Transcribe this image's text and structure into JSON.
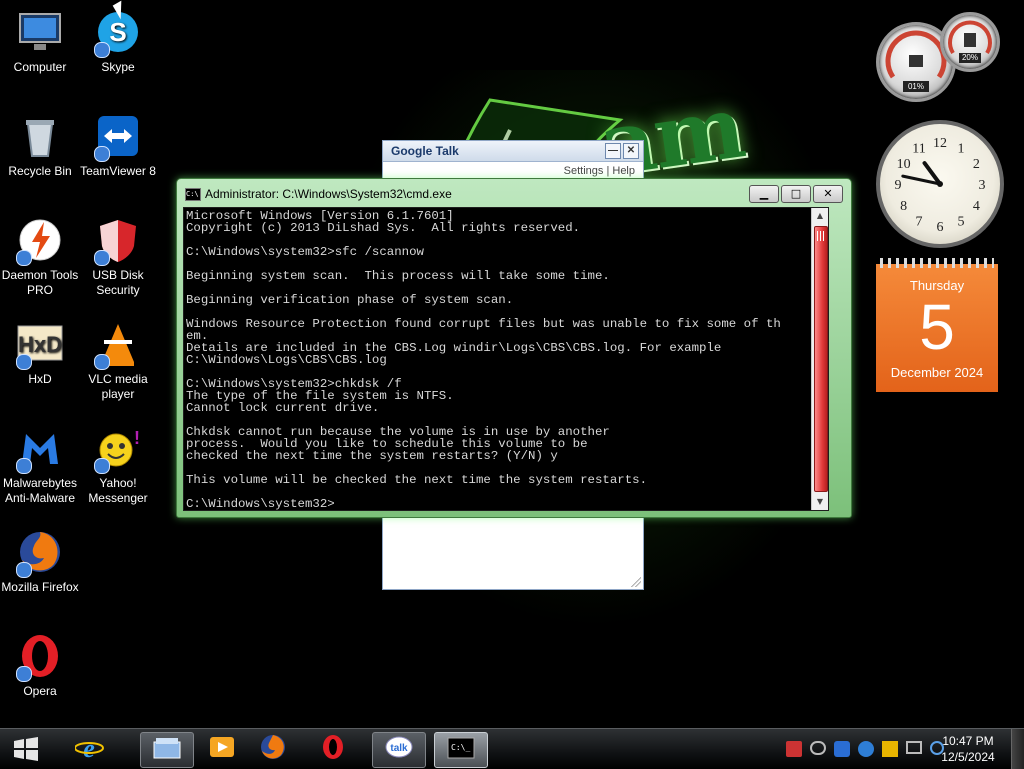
{
  "desktop": {
    "icons": [
      {
        "label": "Computer",
        "icon": "computer-icon"
      },
      {
        "label": "Skype",
        "icon": "skype-icon"
      },
      {
        "label": "Recycle Bin",
        "icon": "recycle-bin-icon"
      },
      {
        "label": "TeamViewer 8",
        "icon": "teamviewer-icon"
      },
      {
        "label": "Daemon Tools PRO",
        "icon": "daemon-tools-icon"
      },
      {
        "label": "USB Disk Security",
        "icon": "usb-disk-security-icon"
      },
      {
        "label": "HxD",
        "icon": "hxd-icon"
      },
      {
        "label": "VLC media player",
        "icon": "vlc-icon"
      },
      {
        "label": "Malwarebytes Anti-Malware",
        "icon": "malwarebytes-icon"
      },
      {
        "label": "Yahoo! Messenger",
        "icon": "yahoo-messenger-icon"
      },
      {
        "label": "Mozilla Firefox",
        "icon": "firefox-icon"
      },
      {
        "label": "Opera",
        "icon": "opera-icon"
      }
    ]
  },
  "gadgets": {
    "cpu_meter": {
      "cpu_percent": "01%",
      "ram_percent": "20%"
    },
    "clock": {
      "hour": 10,
      "minute": 47
    },
    "calendar": {
      "weekday": "Thursday",
      "day": "5",
      "month_year": "December 2024",
      "color": "#ee7a2b"
    }
  },
  "gtalk_window": {
    "title": "Google Talk",
    "links": "Settings | Help",
    "minimize_label": "—",
    "close_label": "✕"
  },
  "cmd_window": {
    "title": "Administrator: C:\\Windows\\System32\\cmd.exe",
    "minimize_label": "▁",
    "maximize_label": "□",
    "close_label": "✕",
    "lines": [
      "Microsoft Windows [Version 6.1.7601]",
      "Copyright (c) 2013 DiLshad Sys.  All rights reserved.",
      "",
      "C:\\Windows\\system32>sfc /scannow",
      "",
      "Beginning system scan.  This process will take some time.",
      "",
      "Beginning verification phase of system scan.",
      "",
      "Windows Resource Protection found corrupt files but was unable to fix some of th",
      "em.",
      "Details are included in the CBS.Log windir\\Logs\\CBS\\CBS.log. For example",
      "C:\\Windows\\Logs\\CBS\\CBS.log",
      "",
      "C:\\Windows\\system32>chkdsk /f",
      "The type of the file system is NTFS.",
      "Cannot lock current drive.",
      "",
      "Chkdsk cannot run because the volume is in use by another",
      "process.  Would you like to schedule this volume to be",
      "checked the next time the system restarts? (Y/N) y",
      "",
      "This volume will be checked the next time the system restarts.",
      "",
      "C:\\Windows\\system32>"
    ]
  },
  "taskbar": {
    "pinned": [
      {
        "name": "internet-explorer-icon"
      },
      {
        "name": "windows-explorer-icon"
      },
      {
        "name": "media-player-icon"
      },
      {
        "name": "firefox-icon"
      },
      {
        "name": "opera-icon"
      },
      {
        "name": "google-talk-icon"
      },
      {
        "name": "cmd-icon"
      }
    ],
    "clock": {
      "time": "10:47 PM",
      "date": "12/5/2024"
    }
  },
  "colors": {
    "cmd_frame": "#9fd89c",
    "scroll_thumb": "#e23b3b",
    "calendar": "#ee7a2b"
  }
}
